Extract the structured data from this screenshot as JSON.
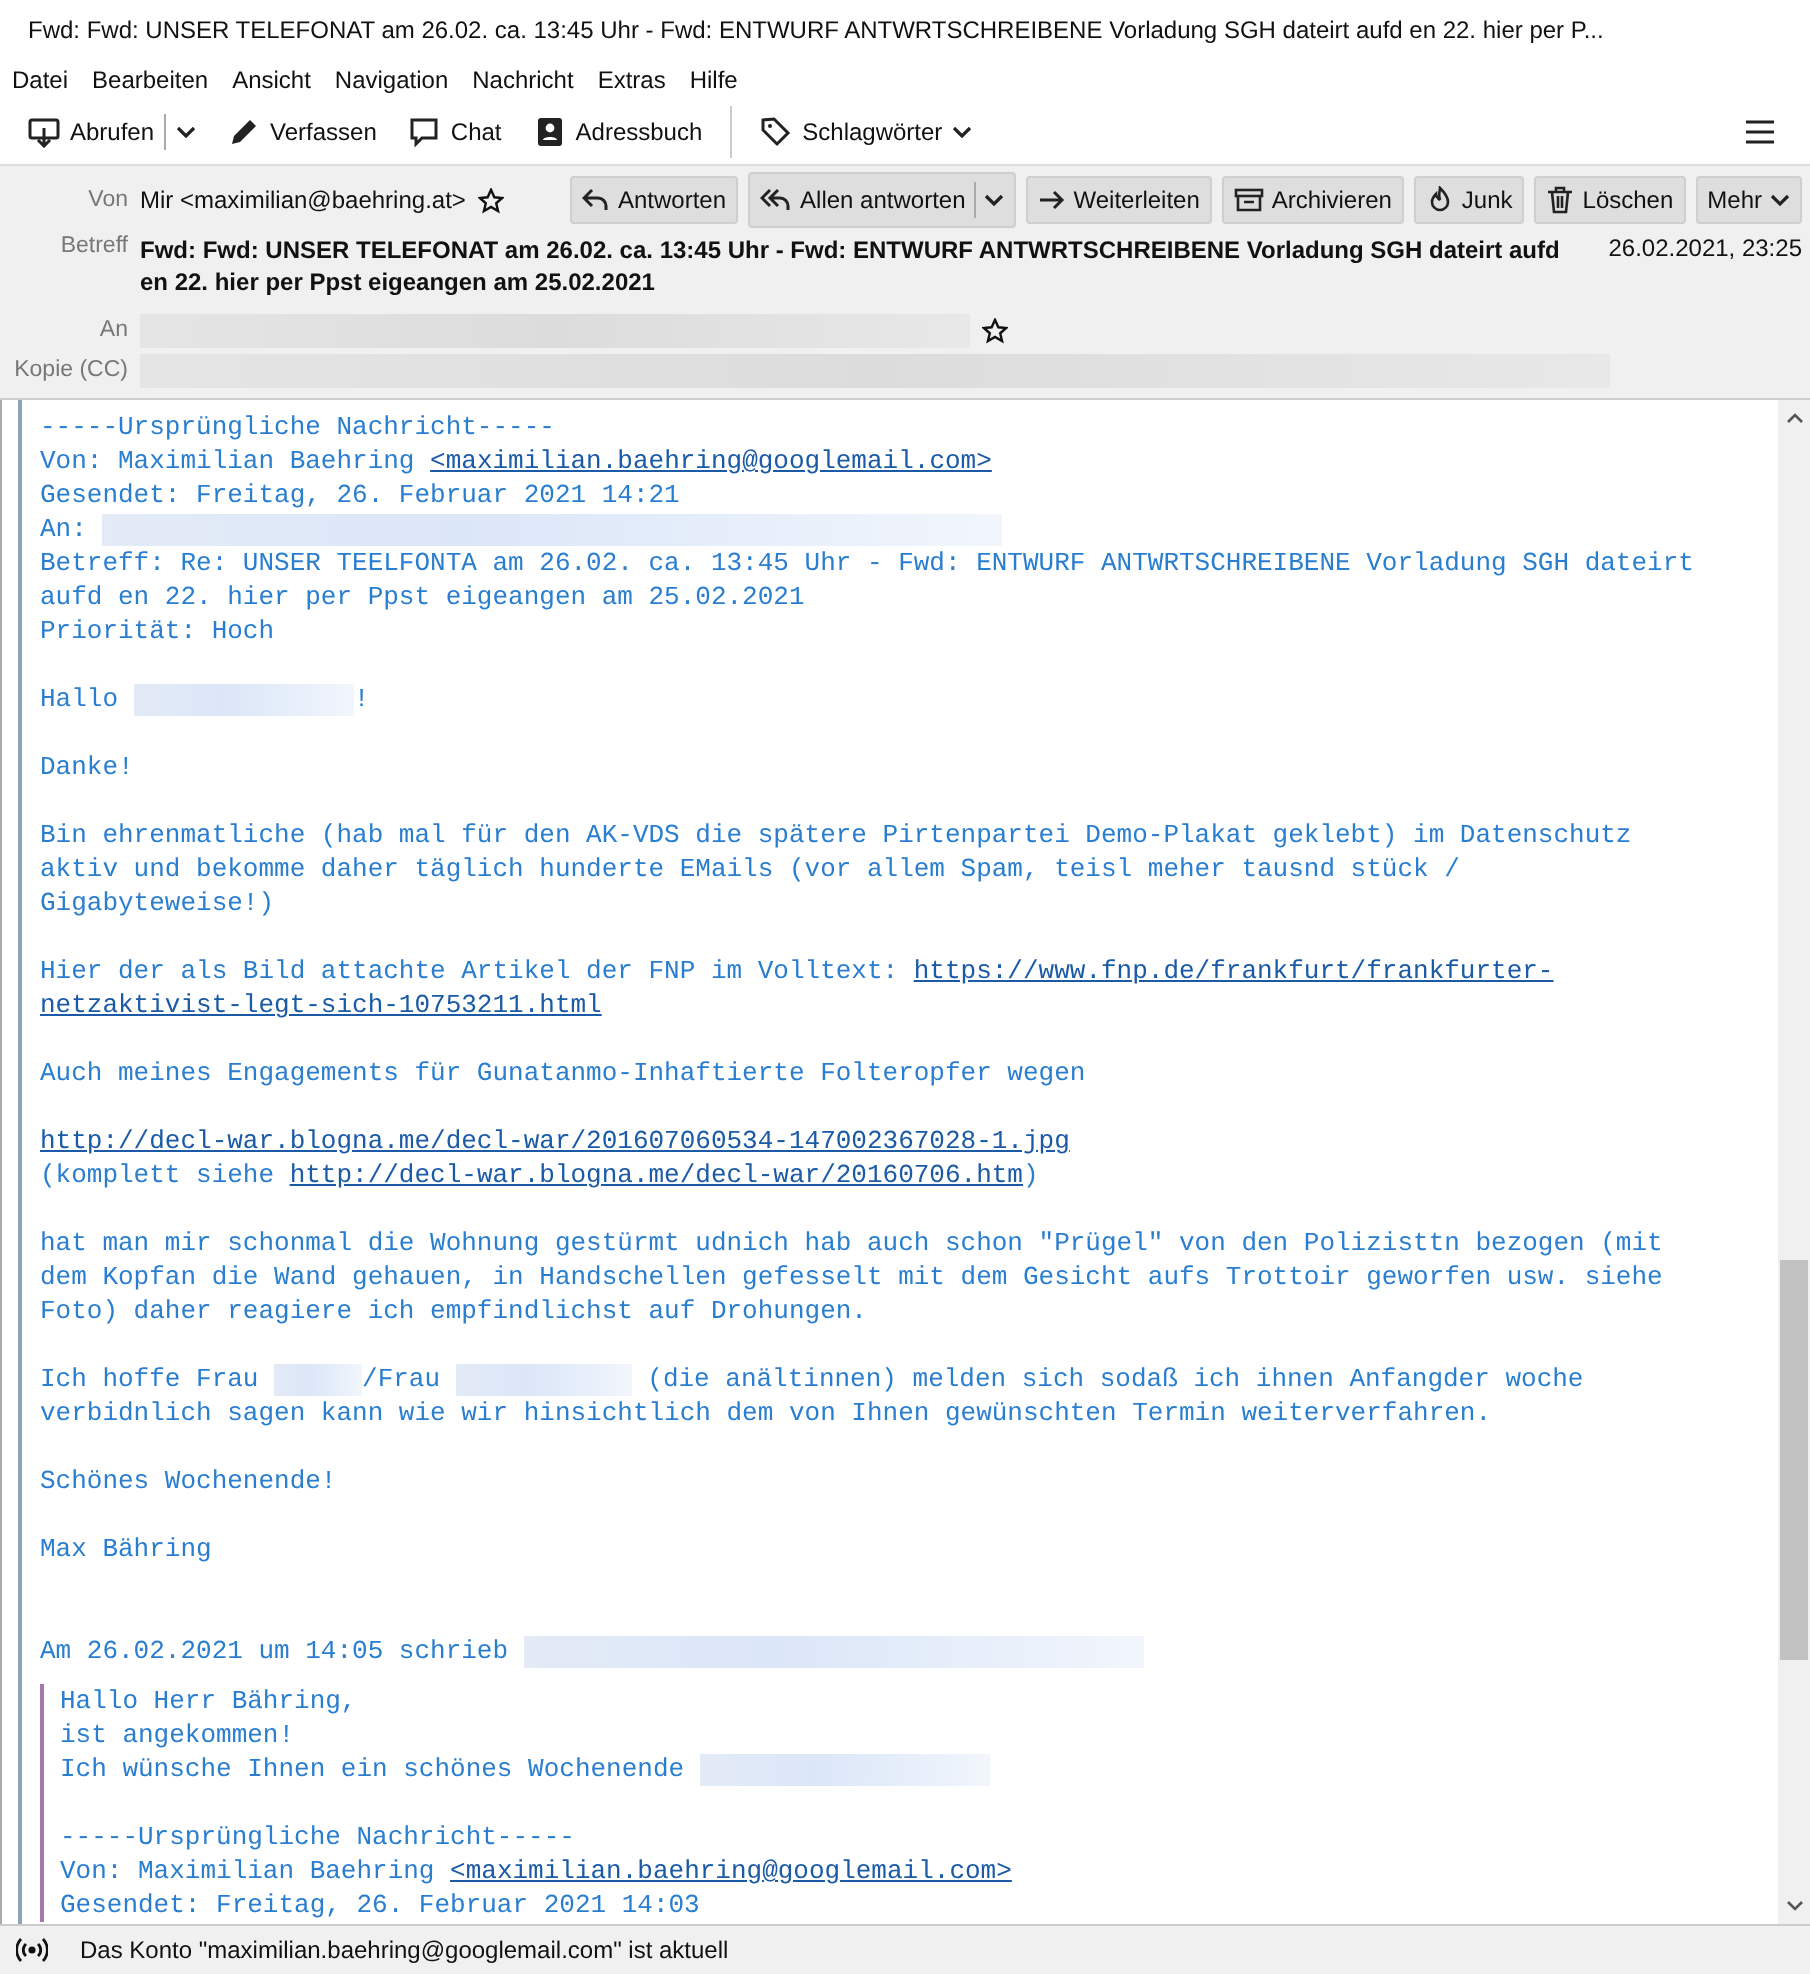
{
  "window": {
    "title": "Fwd: Fwd: UNSER TELEFONAT am 26.02. ca. 13:45 Uhr - Fwd: ENTWURF ANTWRTSCHREIBENE Vorladung SGH dateirt aufd en 22. hier per P..."
  },
  "menu": [
    "Datei",
    "Bearbeiten",
    "Ansicht",
    "Navigation",
    "Nachricht",
    "Extras",
    "Hilfe"
  ],
  "toolbar": [
    {
      "kind": "get",
      "label": "Abrufen",
      "dropdown": true
    },
    {
      "kind": "write",
      "label": "Verfassen",
      "dropdown": false
    },
    {
      "kind": "chat",
      "label": "Chat",
      "dropdown": false
    },
    {
      "kind": "addressbook",
      "label": "Adressbuch",
      "dropdown": false
    },
    {
      "kind": "tag",
      "label": "Schlagwörter",
      "dropdown": true
    }
  ],
  "header": {
    "from_label": "Von",
    "from": "Mir <maximilian@baehring.at>",
    "subject_label": "Betreff",
    "subject": "Fwd: Fwd: UNSER TELEFONAT am 26.02. ca. 13:45 Uhr - Fwd: ENTWURF ANTWRTSCHREIBENE Vorladung SGH dateirt aufd en 22. hier per Ppst eigeangen am 25.02.2021",
    "date": "26.02.2021, 23:25",
    "to_label": "An",
    "cc_label": "Kopie (CC)",
    "actions": [
      {
        "kind": "reply",
        "label": "Antworten",
        "dropdown": false
      },
      {
        "kind": "replyall",
        "label": "Allen antworten",
        "dropdown": true
      },
      {
        "kind": "forward",
        "label": "Weiterleiten",
        "dropdown": false
      },
      {
        "kind": "archive",
        "label": "Archivieren",
        "dropdown": false
      },
      {
        "kind": "junk",
        "label": "Junk",
        "dropdown": false
      },
      {
        "kind": "delete",
        "label": "Löschen",
        "dropdown": false
      },
      {
        "kind": "more",
        "label": "Mehr",
        "dropdown": true
      }
    ]
  },
  "body": [
    {
      "kind": "para",
      "lines": [
        [
          {
            "kind": "text",
            "text": "-----Ursprüngliche Nachricht-----"
          }
        ],
        [
          {
            "kind": "text",
            "text": "Von: Maximilian Baehring "
          },
          {
            "kind": "link",
            "text": "<maximilian.baehring@googlemail.com>"
          }
        ],
        [
          {
            "kind": "text",
            "text": "Gesendet: Freitag, 26. Februar 2021 14:21"
          }
        ],
        [
          {
            "kind": "text",
            "text": "An: "
          },
          {
            "kind": "redacted"
          }
        ],
        [
          {
            "kind": "text",
            "text": "Betreff: Re: UNSER TEELFONTA am 26.02. ca. 13:45 Uhr - Fwd: ENTWURF ANTWRTSCHREIBENE Vorladung SGH dateirt"
          }
        ],
        [
          {
            "kind": "text",
            "text": "aufd en 22. hier per Ppst eigeangen am 25.02.2021"
          }
        ],
        [
          {
            "kind": "text",
            "text": "Priorität: Hoch"
          }
        ]
      ]
    },
    {
      "kind": "para",
      "lines": [
        [
          {
            "kind": "text",
            "text": "Hallo "
          },
          {
            "kind": "redacted"
          },
          {
            "kind": "text",
            "text": "!"
          }
        ]
      ]
    },
    {
      "kind": "para",
      "lines": [
        [
          {
            "kind": "text",
            "text": "Danke!"
          }
        ]
      ]
    },
    {
      "kind": "para",
      "lines": [
        [
          {
            "kind": "text",
            "text": "Bin ehrenmatliche (hab mal für den AK-VDS die spätere Pirtenpartei Demo-Plakat geklebt) im Datenschutz"
          }
        ],
        [
          {
            "kind": "text",
            "text": "aktiv und bekomme daher täglich hunderte EMails (vor allem Spam, teisl meher tausnd stück /"
          }
        ],
        [
          {
            "kind": "text",
            "text": "Gigabyteweise!)"
          }
        ]
      ]
    },
    {
      "kind": "para",
      "lines": [
        [
          {
            "kind": "text",
            "text": "Hier der als Bild attachte Artikel der FNP im Volltext: "
          },
          {
            "kind": "link",
            "text": "https://www.fnp.de/frankfurt/frankfurter-"
          }
        ],
        [
          {
            "kind": "link",
            "text": "netzaktivist-legt-sich-10753211.html"
          }
        ]
      ]
    },
    {
      "kind": "para",
      "lines": [
        [
          {
            "kind": "text",
            "text": "Auch meines Engagements für Gunatanmo-Inhaftierte Folteropfer wegen"
          }
        ]
      ]
    },
    {
      "kind": "para",
      "lines": [
        [
          {
            "kind": "link",
            "text": "http://decl-war.blogna.me/decl-war/201607060534-147002367028-1.jpg"
          }
        ],
        [
          {
            "kind": "text",
            "text": "(komplett siehe "
          },
          {
            "kind": "link",
            "text": "http://decl-war.blogna.me/decl-war/20160706.htm"
          },
          {
            "kind": "text",
            "text": ")"
          }
        ]
      ]
    },
    {
      "kind": "para",
      "lines": [
        [
          {
            "kind": "text",
            "text": "hat man mir schonmal die Wohnung gestürmt udnich hab auch schon \"Prügel\" von den Polizisttn bezogen (mit"
          }
        ],
        [
          {
            "kind": "text",
            "text": "dem Kopfan die Wand gehauen, in Handschellen gefesselt mit dem Gesicht aufs Trottoir geworfen usw. siehe"
          }
        ],
        [
          {
            "kind": "text",
            "text": "Foto) daher reagiere ich empfindlichst auf Drohungen."
          }
        ]
      ]
    },
    {
      "kind": "para",
      "lines": [
        [
          {
            "kind": "text",
            "text": "Ich hoffe Frau "
          },
          {
            "kind": "redacted"
          },
          {
            "kind": "text",
            "text": "/Frau "
          },
          {
            "kind": "redacted"
          },
          {
            "kind": "text",
            "text": " (die anältinnen) melden sich sodaß ich ihnen Anfangder woche"
          }
        ],
        [
          {
            "kind": "text",
            "text": "verbidnlich sagen kann wie wir hinsichtlich dem von Ihnen gewünschten Termin weiterverfahren."
          }
        ]
      ]
    },
    {
      "kind": "para",
      "lines": [
        [
          {
            "kind": "text",
            "text": "Schönes Wochenende!"
          }
        ]
      ]
    },
    {
      "kind": "para",
      "lines": [
        [
          {
            "kind": "text",
            "text": "Max Bähring"
          }
        ]
      ]
    },
    {
      "kind": "cite",
      "lines": [
        [
          {
            "kind": "text",
            "text": "Am 26.02.2021 um 14:05 schrieb "
          },
          {
            "kind": "redacted"
          }
        ]
      ]
    },
    {
      "kind": "quote",
      "blocks": [
        {
          "kind": "para",
          "lines": [
            [
              {
                "kind": "text",
                "text": "Hallo Herr Bähring,"
              }
            ],
            [
              {
                "kind": "text",
                "text": "ist angekommen!"
              }
            ],
            [
              {
                "kind": "text",
                "text": "Ich wünsche Ihnen ein schönes Wochenende "
              },
              {
                "kind": "redacted"
              }
            ]
          ]
        },
        {
          "kind": "para",
          "lines": [
            [
              {
                "kind": "text",
                "text": "-----Ursprüngliche Nachricht-----"
              }
            ],
            [
              {
                "kind": "text",
                "text": "Von: Maximilian Baehring "
              },
              {
                "kind": "link",
                "text": "<maximilian.baehring@googlemail.com>"
              }
            ],
            [
              {
                "kind": "text",
                "text": "Gesendet: Freitag, 26. Februar 2021 14:03"
              }
            ]
          ]
        }
      ]
    }
  ],
  "status_bar": {
    "text": "Das Konto \"maximilian.baehring@googlemail.com\" ist aktuell"
  }
}
